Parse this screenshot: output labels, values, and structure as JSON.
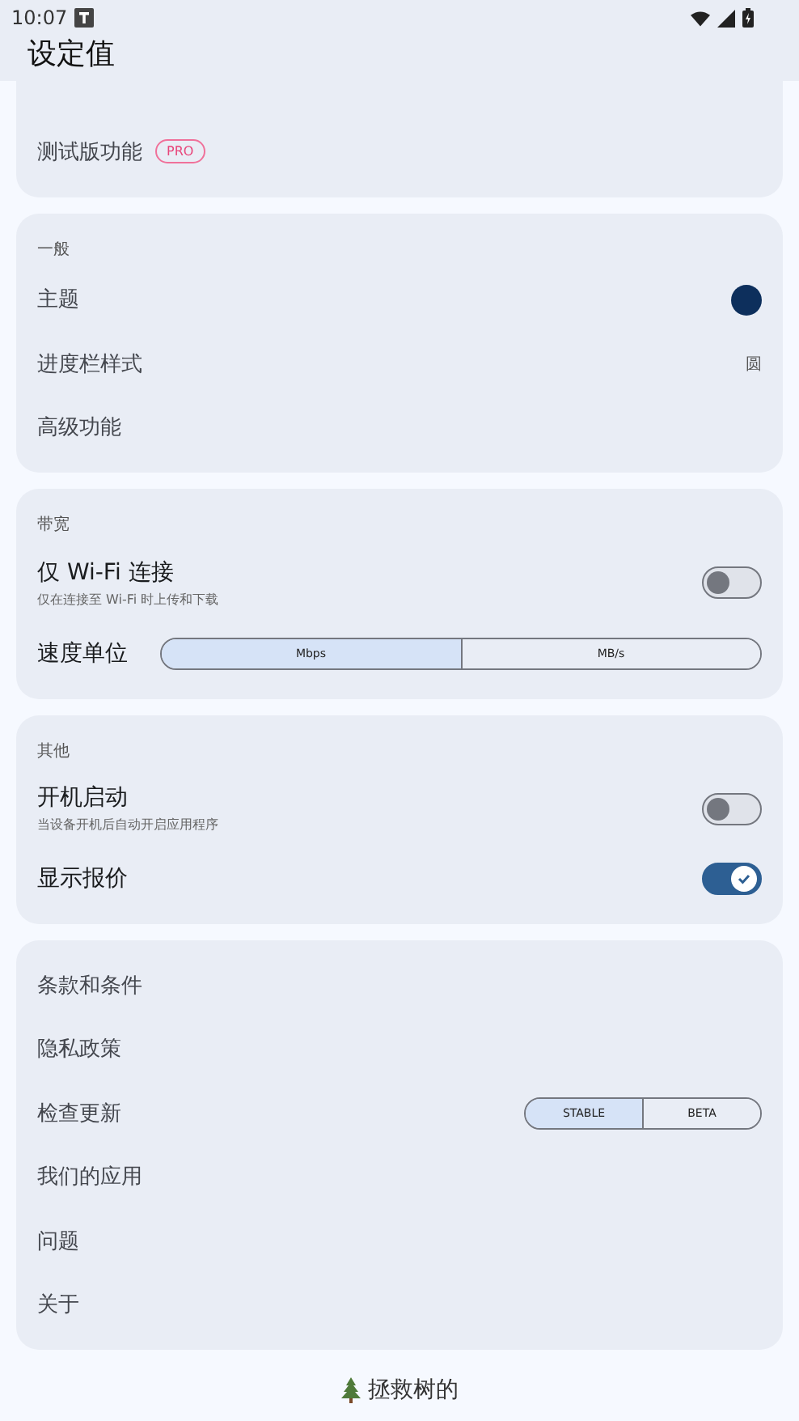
{
  "status_bar": {
    "time": "10:07"
  },
  "app_bar": {
    "title": "设定值"
  },
  "sections": [
    {
      "rows": [
        {
          "kind": "badge",
          "label": "测试版功能",
          "badge": "PRO"
        }
      ]
    },
    {
      "header": "一般",
      "rows": [
        {
          "kind": "color",
          "label": "主题",
          "color": "#0d2f5c"
        },
        {
          "kind": "value",
          "label": "进度栏样式",
          "value": "圆"
        },
        {
          "kind": "plain",
          "label": "高级功能"
        }
      ]
    },
    {
      "header": "带宽",
      "rows": [
        {
          "kind": "toggle",
          "label": "仅 Wi-Fi 连接",
          "subtitle": "仅在连接至 Wi-Fi 时上传和下载",
          "on": false
        },
        {
          "kind": "segmented",
          "label": "速度单位",
          "wide": true,
          "options": [
            {
              "label": "Mbps",
              "selected": true
            },
            {
              "label": "MB/s",
              "selected": false
            }
          ]
        }
      ]
    },
    {
      "header": "其他",
      "rows": [
        {
          "kind": "toggle",
          "label": "开机启动",
          "subtitle": "当设备开机后自动开启应用程序",
          "on": false
        },
        {
          "kind": "toggle",
          "label": "显示报价",
          "on": true
        }
      ]
    },
    {
      "rows": [
        {
          "kind": "plain",
          "label": "条款和条件"
        },
        {
          "kind": "plain",
          "label": "隐私政策"
        },
        {
          "kind": "segmented",
          "label": "检查更新",
          "wide": false,
          "options": [
            {
              "label": "STABLE",
              "selected": true
            },
            {
              "label": "BETA",
              "selected": false
            }
          ]
        },
        {
          "kind": "plain",
          "label": "我们的应用"
        },
        {
          "kind": "plain",
          "label": "问题"
        },
        {
          "kind": "plain",
          "label": "关于"
        }
      ]
    }
  ],
  "footer": {
    "text": "拯救树的"
  }
}
